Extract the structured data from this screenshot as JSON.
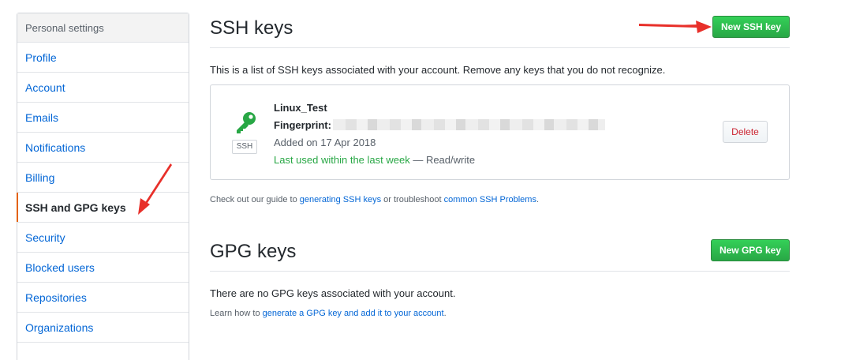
{
  "sidebar": {
    "header": "Personal settings",
    "items": [
      {
        "label": "Profile"
      },
      {
        "label": "Account"
      },
      {
        "label": "Emails"
      },
      {
        "label": "Notifications"
      },
      {
        "label": "Billing"
      },
      {
        "label": "SSH and GPG keys",
        "selected": true
      },
      {
        "label": "Security"
      },
      {
        "label": "Blocked users"
      },
      {
        "label": "Repositories"
      },
      {
        "label": "Organizations"
      }
    ]
  },
  "ssh": {
    "title": "SSH keys",
    "new_button": "New SSH key",
    "intro": "This is a list of SSH keys associated with your account. Remove any keys that you do not recognize.",
    "key": {
      "name": "Linux_Test",
      "fingerprint_label": "Fingerprint:",
      "badge": "SSH",
      "added": "Added on 17 Apr 2018",
      "last_used": "Last used within the last week",
      "access": " — Read/write",
      "delete_label": "Delete"
    },
    "guide": {
      "prefix": "Check out our guide to ",
      "link1": "generating SSH keys",
      "middle": " or troubleshoot ",
      "link2": "common SSH Problems",
      "suffix": "."
    }
  },
  "gpg": {
    "title": "GPG keys",
    "new_button": "New GPG key",
    "none_text": "There are no GPG keys associated with your account.",
    "learn": {
      "prefix": "Learn how to ",
      "link": "generate a GPG key and add it to your account",
      "suffix": "."
    }
  },
  "colors": {
    "accent_green": "#28a745",
    "link_blue": "#0366d6",
    "danger_red": "#cb2431",
    "selected_marker": "#e36209",
    "annotation_arrow": "#e8302a"
  },
  "icons": {
    "key": "key-icon",
    "annotation": "arrow-icon"
  }
}
